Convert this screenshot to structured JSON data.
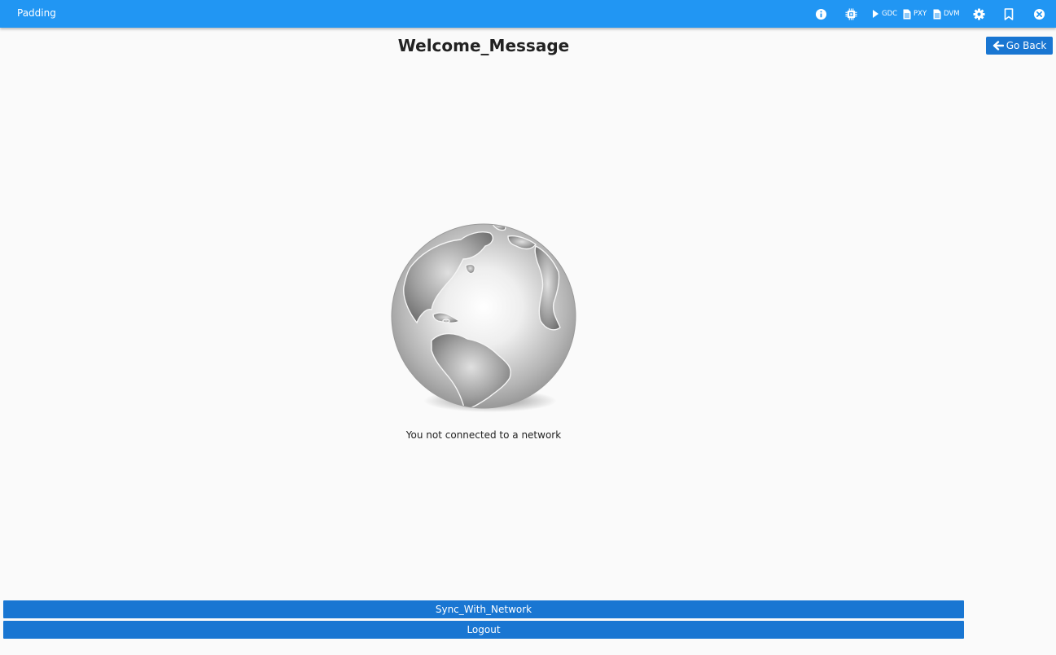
{
  "app": {
    "title": "Padding"
  },
  "toolbar": {
    "gdc_label": "GDC",
    "pxy_label": "PXY",
    "dvm_label": "DVM",
    "icons": [
      "info-icon",
      "chip-icon",
      "play-icon",
      "file-icon",
      "file-icon",
      "gear-icon",
      "bookmark-icon",
      "close-icon"
    ]
  },
  "main": {
    "title": "Welcome_Message",
    "back_label": "Go Back",
    "status": "You not connected to a network",
    "illustration": "globe-icon"
  },
  "actions": {
    "sync_label": "Sync_With_Network",
    "logout_label": "Logout"
  },
  "colors": {
    "topbar": "#2196f3",
    "button": "#1976d2",
    "background": "#fafafa"
  }
}
